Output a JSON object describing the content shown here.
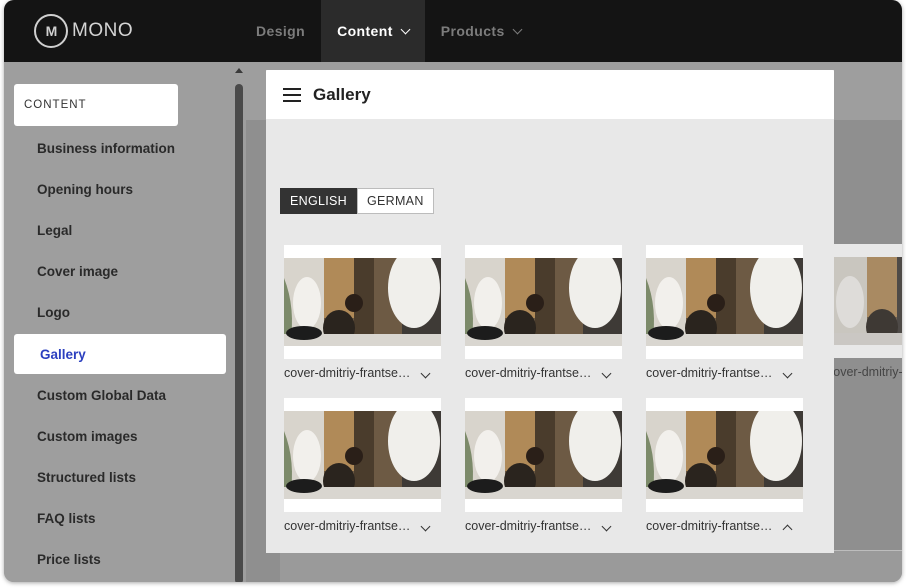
{
  "app": {
    "logo_mark": "M",
    "logo_text": "MONO"
  },
  "nav": [
    {
      "label": "Design",
      "active": false,
      "has_menu": false
    },
    {
      "label": "Content",
      "active": true,
      "has_menu": true
    },
    {
      "label": "Products",
      "active": false,
      "has_menu": true
    }
  ],
  "sidebar": {
    "header": "CONTENT",
    "items": [
      {
        "label": "Business information"
      },
      {
        "label": "Opening hours"
      },
      {
        "label": "Legal"
      },
      {
        "label": "Cover image"
      },
      {
        "label": "Logo"
      },
      {
        "label": "Gallery",
        "active": true
      },
      {
        "label": "Custom Global Data"
      },
      {
        "label": "Custom images"
      },
      {
        "label": "Structured lists"
      },
      {
        "label": "FAQ lists"
      },
      {
        "label": "Price lists"
      }
    ]
  },
  "panel": {
    "title": "Gallery",
    "languages": [
      {
        "label": "ENGLISH",
        "active": true
      },
      {
        "label": "GERMAN",
        "active": false
      }
    ],
    "images": [
      {
        "caption": "cover-dmitriy-frantse…",
        "chevron": "down"
      },
      {
        "caption": "cover-dmitriy-frantse…",
        "chevron": "down"
      },
      {
        "caption": "cover-dmitriy-frantse…",
        "chevron": "down"
      },
      {
        "caption": "cover-dmitriy-frantse…",
        "chevron": "down"
      },
      {
        "caption": "cover-dmitriy-frantse…",
        "chevron": "down"
      },
      {
        "caption": "cover-dmitriy-frantse…",
        "chevron": "up"
      }
    ],
    "overflow_caption": "cover-dmitriy-"
  },
  "colors": {
    "accent": "#2b3fbf",
    "topbar": "#141414",
    "overlay": "#9e9e9e"
  }
}
